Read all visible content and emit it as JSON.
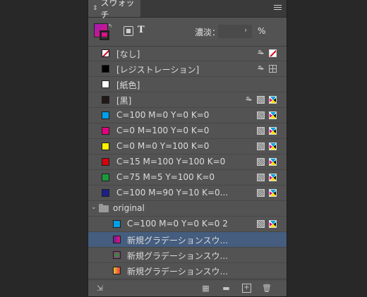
{
  "panel": {
    "tab_label": "スウォッチ",
    "tint_label": "濃淡：",
    "tint_value": "",
    "tint_unit": "%",
    "text_toggle": "T"
  },
  "swatches": [
    {
      "label": "[なし]",
      "chip": "none",
      "chip_color": "#ffffff",
      "icons": [
        "noedit-icon",
        "none-mode-icon"
      ]
    },
    {
      "label": "[レジストレーション]",
      "chip": "solid",
      "chip_color": "#000000",
      "icons": [
        "noedit-icon",
        "registration-mode-icon"
      ]
    },
    {
      "label": "[紙色]",
      "chip": "solid",
      "chip_color": "#ffffff",
      "icons": []
    },
    {
      "label": "[黒]",
      "chip": "solid",
      "chip_color": "#231815",
      "icons": [
        "noedit-icon",
        "process-icon",
        "cmyk-icon"
      ]
    },
    {
      "label": "C=100 M=0 Y=0 K=0",
      "chip": "solid",
      "chip_color": "#00a0e9",
      "icons": [
        "process-icon",
        "cmyk-icon"
      ]
    },
    {
      "label": "C=0 M=100 Y=0 K=0",
      "chip": "solid",
      "chip_color": "#e4007f",
      "icons": [
        "process-icon",
        "cmyk-icon"
      ]
    },
    {
      "label": "C=0 M=0 Y=100 K=0",
      "chip": "solid",
      "chip_color": "#fff100",
      "icons": [
        "process-icon",
        "cmyk-icon"
      ]
    },
    {
      "label": "C=15 M=100 Y=100 K=0",
      "chip": "solid",
      "chip_color": "#d7000f",
      "icons": [
        "process-icon",
        "cmyk-icon"
      ]
    },
    {
      "label": "C=75 M=5 Y=100 K=0",
      "chip": "solid",
      "chip_color": "#1a9a3a",
      "icons": [
        "process-icon",
        "cmyk-icon"
      ]
    },
    {
      "label": "C=100 M=90 Y=10 K=0...",
      "chip": "solid",
      "chip_color": "#1d2088",
      "icons": [
        "process-icon",
        "cmyk-icon"
      ]
    }
  ],
  "group": {
    "label": "original",
    "items": [
      {
        "label": "C=100 M=0 Y=0 K=0 2",
        "chip": "solid",
        "chip_color": "#00a0e9",
        "icons": [
          "process-icon",
          "cmyk-icon"
        ]
      },
      {
        "label": "新規グラデーションスウ...",
        "chip": "gradient-linear",
        "chip_color": "#7b2cbf",
        "icons": [],
        "selected": true
      },
      {
        "label": "新規グラデーションスウ...",
        "chip": "gradient-radial",
        "chip_color": "#7a3a8a",
        "icons": []
      },
      {
        "label": "新規グラデーションスウ...",
        "chip": "gradient-warm",
        "chip_color": "#f59a23",
        "icons": []
      }
    ]
  },
  "colors": {
    "panel_bg": "#535353",
    "selection": "#455d7e"
  }
}
